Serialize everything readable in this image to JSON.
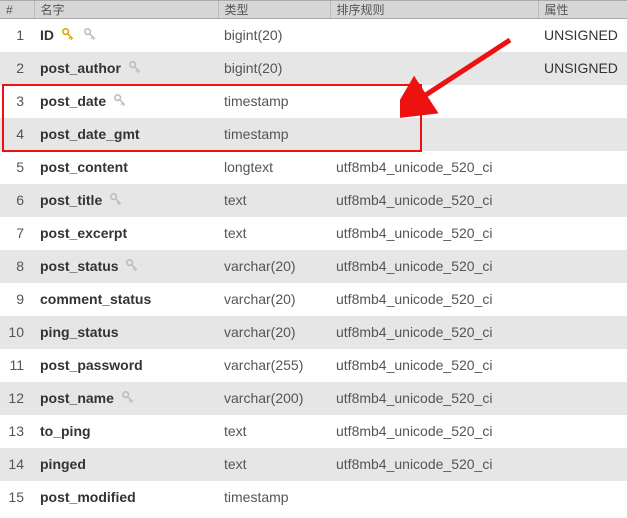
{
  "headers": {
    "idx": "#",
    "name": "名字",
    "type": "类型",
    "collation": "排序规则",
    "attr": "属性"
  },
  "rows": [
    {
      "n": "1",
      "name": "ID",
      "type": "bigint(20)",
      "collation": "",
      "attr": "UNSIGNED",
      "pk": true,
      "idx": true
    },
    {
      "n": "2",
      "name": "post_author",
      "type": "bigint(20)",
      "collation": "",
      "attr": "UNSIGNED",
      "pk": false,
      "idx": true
    },
    {
      "n": "3",
      "name": "post_date",
      "type": "timestamp",
      "collation": "",
      "attr": "",
      "pk": false,
      "idx": true
    },
    {
      "n": "4",
      "name": "post_date_gmt",
      "type": "timestamp",
      "collation": "",
      "attr": "",
      "pk": false,
      "idx": false
    },
    {
      "n": "5",
      "name": "post_content",
      "type": "longtext",
      "collation": "utf8mb4_unicode_520_ci",
      "attr": "",
      "pk": false,
      "idx": false
    },
    {
      "n": "6",
      "name": "post_title",
      "type": "text",
      "collation": "utf8mb4_unicode_520_ci",
      "attr": "",
      "pk": false,
      "idx": true
    },
    {
      "n": "7",
      "name": "post_excerpt",
      "type": "text",
      "collation": "utf8mb4_unicode_520_ci",
      "attr": "",
      "pk": false,
      "idx": false
    },
    {
      "n": "8",
      "name": "post_status",
      "type": "varchar(20)",
      "collation": "utf8mb4_unicode_520_ci",
      "attr": "",
      "pk": false,
      "idx": true
    },
    {
      "n": "9",
      "name": "comment_status",
      "type": "varchar(20)",
      "collation": "utf8mb4_unicode_520_ci",
      "attr": "",
      "pk": false,
      "idx": false
    },
    {
      "n": "10",
      "name": "ping_status",
      "type": "varchar(20)",
      "collation": "utf8mb4_unicode_520_ci",
      "attr": "",
      "pk": false,
      "idx": false
    },
    {
      "n": "11",
      "name": "post_password",
      "type": "varchar(255)",
      "collation": "utf8mb4_unicode_520_ci",
      "attr": "",
      "pk": false,
      "idx": false
    },
    {
      "n": "12",
      "name": "post_name",
      "type": "varchar(200)",
      "collation": "utf8mb4_unicode_520_ci",
      "attr": "",
      "pk": false,
      "idx": true
    },
    {
      "n": "13",
      "name": "to_ping",
      "type": "text",
      "collation": "utf8mb4_unicode_520_ci",
      "attr": "",
      "pk": false,
      "idx": false
    },
    {
      "n": "14",
      "name": "pinged",
      "type": "text",
      "collation": "utf8mb4_unicode_520_ci",
      "attr": "",
      "pk": false,
      "idx": false
    },
    {
      "n": "15",
      "name": "post_modified",
      "type": "timestamp",
      "collation": "",
      "attr": "",
      "pk": false,
      "idx": false
    }
  ],
  "annotation": {
    "highlight_rows": [
      3,
      4
    ],
    "arrow_color": "#e11"
  }
}
